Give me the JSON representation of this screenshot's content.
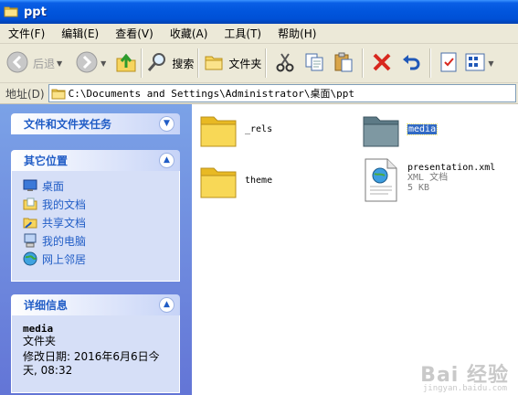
{
  "window": {
    "title": "ppt"
  },
  "menu": [
    "文件(F)",
    "编辑(E)",
    "查看(V)",
    "收藏(A)",
    "工具(T)",
    "帮助(H)"
  ],
  "toolbar": {
    "back_label": "后退",
    "search_label": "搜索",
    "folders_label": "文件夹"
  },
  "address": {
    "label": "地址(D)",
    "path": "C:\\Documents and Settings\\Administrator\\桌面\\ppt"
  },
  "tasks_panel": {
    "title": "文件和文件夹任务"
  },
  "places_panel": {
    "title": "其它位置",
    "items": [
      "桌面",
      "我的文档",
      "共享文档",
      "我的电脑",
      "网上邻居"
    ]
  },
  "details_panel": {
    "title": "详细信息",
    "name": "media",
    "type": "文件夹",
    "modified_line1": "修改日期: 2016年6月6日今",
    "modified_line2": "天, 08:32"
  },
  "files": [
    {
      "name": "_rels",
      "kind": "folder"
    },
    {
      "name": "media",
      "kind": "folder",
      "selected": true
    },
    {
      "name": "theme",
      "kind": "folder"
    },
    {
      "name": "presentation.xml",
      "kind": "xml",
      "type": "XML 文档",
      "size": "5 KB"
    }
  ],
  "watermark": {
    "text": "Bai 经验",
    "sub": "jingyan.baidu.com"
  },
  "colors": {
    "titlebar": "#0155dc",
    "link": "#215dc6",
    "selection": "#316ac5",
    "pane": "#7ba2e7"
  }
}
